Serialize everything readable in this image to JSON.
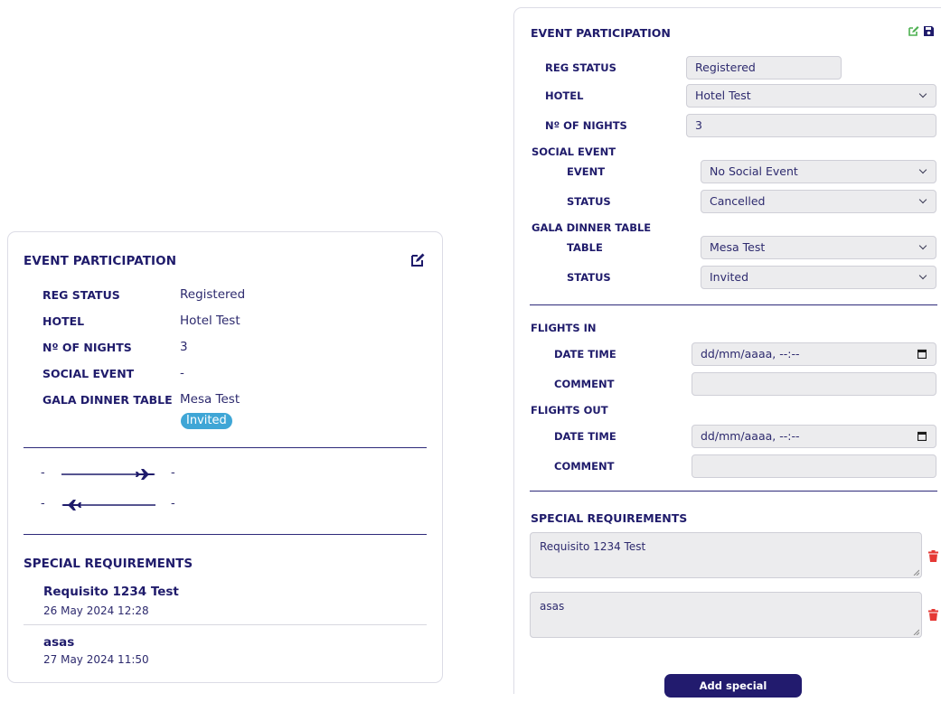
{
  "view": {
    "title": "EVENT PARTICIPATION",
    "fields": [
      {
        "label": "REG STATUS",
        "value": "Registered"
      },
      {
        "label": "HOTEL",
        "value": "Hotel Test"
      },
      {
        "label": "Nº OF NIGHTS",
        "value": "3"
      },
      {
        "label": "SOCIAL EVENT",
        "value": "-"
      },
      {
        "label": "GALA DINNER TABLE",
        "value": "Mesa Test"
      }
    ],
    "gala_badge": "Invited",
    "flight_in": {
      "from": "-",
      "to": "-"
    },
    "flight_out": {
      "from": "-",
      "to": "-"
    },
    "special_title": "SPECIAL REQUIREMENTS",
    "requirements": [
      {
        "name": "Requisito 1234 Test",
        "date": "26 May 2024 12:28"
      },
      {
        "name": "asas",
        "date": "27 May 2024 11:50"
      }
    ]
  },
  "edit": {
    "title": "EVENT PARTICIPATION",
    "reg_status": {
      "label": "REG STATUS",
      "value": "Registered"
    },
    "hotel": {
      "label": "HOTEL",
      "value": "Hotel Test"
    },
    "nights": {
      "label": "Nº OF NIGHTS",
      "value": "3"
    },
    "social_event": {
      "label": "SOCIAL EVENT",
      "event_label": "EVENT",
      "event_value": "No Social Event",
      "status_label": "STATUS",
      "status_value": "Cancelled"
    },
    "gala": {
      "label": "GALA DINNER TABLE",
      "table_label": "TABLE",
      "table_value": "Mesa Test",
      "status_label": "STATUS",
      "status_value": "Invited"
    },
    "flights_in": {
      "label": "FLIGHTS IN",
      "date_label": "DATE TIME",
      "date_placeholder": "dd/mm/aaaa, --:--",
      "comment_label": "COMMENT"
    },
    "flights_out": {
      "label": "FLIGHTS OUT",
      "date_label": "DATE TIME",
      "date_placeholder": "dd/mm/aaaa, --:--",
      "comment_label": "COMMENT"
    },
    "special_title": "SPECIAL REQUIREMENTS",
    "requirements": [
      "Requisito 1234 Test",
      "asas"
    ],
    "add_button": "Add special requirement"
  },
  "colors": {
    "primary": "#1f1b6b",
    "badge": "#3fa6d6",
    "edit_icon": "#4cb050",
    "trash": "#e53935"
  }
}
